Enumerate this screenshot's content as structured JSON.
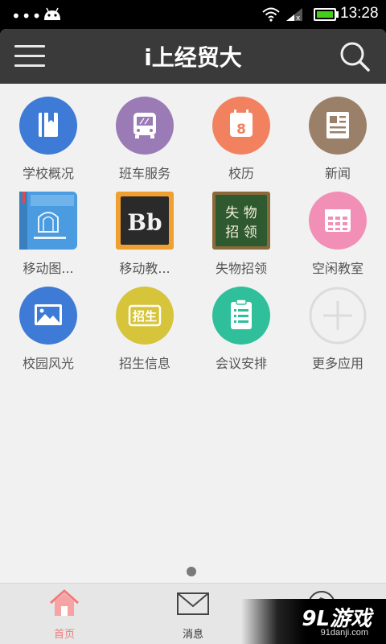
{
  "status_bar": {
    "time": "13:28",
    "battery_level": 1.0,
    "icons": [
      "more-dots-icon",
      "android-icon",
      "wifi-icon",
      "signal-icon",
      "battery-icon"
    ]
  },
  "header": {
    "title": "i上经贸大",
    "menu_icon": "hamburger-menu-icon",
    "search_icon": "search-icon"
  },
  "apps": [
    {
      "label": "学校概况",
      "icon": "book-icon",
      "color": "#3d7bd6"
    },
    {
      "label": "班车服务",
      "icon": "bus-icon",
      "color": "#9b7bb5"
    },
    {
      "label": "校历",
      "icon": "calendar-icon",
      "color": "#f2815f",
      "icon_text": "8"
    },
    {
      "label": "新闻",
      "icon": "newspaper-icon",
      "color": "#9a8068"
    },
    {
      "label": "移动图...",
      "icon": "library-icon",
      "color": "#4a9be0"
    },
    {
      "label": "移动教...",
      "icon": "blackboard-icon",
      "color": "#f0a030",
      "icon_text": "Bb"
    },
    {
      "label": "失物招领",
      "icon": "chalkboard-icon",
      "color": "#2f5a2f",
      "icon_text": "失 物\n招 领"
    },
    {
      "label": "空闲教室",
      "icon": "grid-icon",
      "color": "#f28fb6"
    },
    {
      "label": "校园风光",
      "icon": "picture-icon",
      "color": "#3d7bd6"
    },
    {
      "label": "招生信息",
      "icon": "stamp-icon",
      "color": "#d6c43a",
      "icon_text": "招生"
    },
    {
      "label": "会议安排",
      "icon": "clipboard-icon",
      "color": "#2fbf9a"
    },
    {
      "label": "更多应用",
      "icon": "add-icon",
      "color": "#dcdcdc"
    }
  ],
  "tabs": [
    {
      "label": "首页",
      "icon": "home-icon",
      "active": true
    },
    {
      "label": "消息",
      "icon": "mail-icon",
      "active": false
    },
    {
      "label": "",
      "icon": "music-icon",
      "active": false
    }
  ],
  "watermark": {
    "brand": "9L游戏",
    "url": "91danji.com"
  }
}
